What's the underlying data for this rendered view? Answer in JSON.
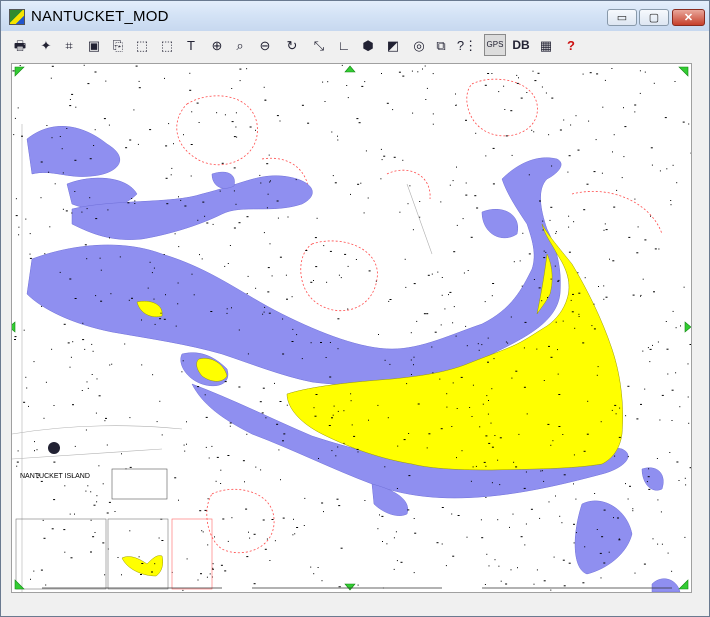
{
  "window": {
    "title": "NANTUCKET_MOD",
    "controls": {
      "minimize": "▭",
      "maximize": "▢",
      "close": "✕"
    }
  },
  "toolbar": {
    "buttons": [
      {
        "name": "print-button",
        "icon": "printer-icon",
        "glyph": "🖶"
      },
      {
        "name": "chart-tools-button",
        "icon": "chart-tools-icon",
        "glyph": "✦"
      },
      {
        "name": "graph-button",
        "icon": "graph-icon",
        "glyph": "⌗"
      },
      {
        "name": "export-button",
        "icon": "export-icon",
        "glyph": "▣"
      },
      {
        "name": "copy-button",
        "icon": "copy-icon",
        "glyph": "⎘"
      },
      {
        "name": "crop-button",
        "icon": "crop-icon",
        "glyph": "⬚"
      },
      {
        "name": "select-region-button",
        "icon": "select-region-icon",
        "glyph": "⬚"
      },
      {
        "name": "text-button",
        "icon": "text-icon",
        "glyph": "T"
      },
      {
        "name": "zoom-in-button",
        "icon": "zoom-in-icon",
        "glyph": "⊕"
      },
      {
        "name": "zoom-extent-button",
        "icon": "zoom-extent-icon",
        "glyph": "⌕"
      },
      {
        "name": "zoom-out-button",
        "icon": "zoom-out-icon",
        "glyph": "⊖"
      },
      {
        "name": "redraw-button",
        "icon": "redraw-icon",
        "glyph": "↻"
      },
      {
        "name": "measure-line-button",
        "icon": "measure-line-icon",
        "glyph": "⤡"
      },
      {
        "name": "measure-angle-button",
        "icon": "measure-angle-icon",
        "glyph": "∟"
      },
      {
        "name": "polygon-fill-button",
        "icon": "polygon-fill-icon",
        "glyph": "⬢"
      },
      {
        "name": "area-fill-button",
        "icon": "area-fill-icon",
        "glyph": "◩"
      },
      {
        "name": "target-button",
        "icon": "target-icon",
        "glyph": "◎"
      },
      {
        "name": "overlay-button",
        "icon": "overlay-icon",
        "glyph": "⧉"
      },
      {
        "name": "query-button",
        "icon": "query-icon",
        "glyph": "?⋮"
      },
      {
        "name": "gps-button",
        "icon": "gps-icon",
        "glyph": "GPS",
        "pressed": true
      },
      {
        "name": "database-button",
        "icon": "database-icon",
        "glyph": "DB"
      },
      {
        "name": "legend-button",
        "icon": "legend-icon",
        "glyph": "▦"
      },
      {
        "name": "help-button",
        "icon": "help-icon",
        "glyph": "?"
      }
    ]
  },
  "map": {
    "chart_name": "NANTUCKET ISLAND",
    "colors": {
      "water_shallow": "#8f8ff0",
      "land": "#ffff00",
      "depth_contour": "#ff4444",
      "soundings": "#000000",
      "corner_marker": "#33cc33"
    }
  }
}
